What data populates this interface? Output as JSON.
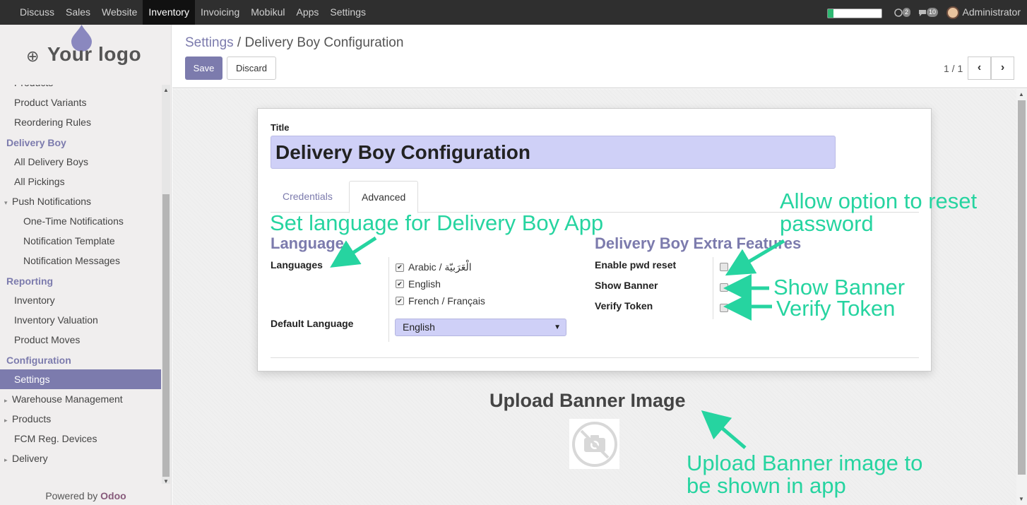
{
  "topbar": {
    "menu": [
      "Discuss",
      "Sales",
      "Website",
      "Inventory",
      "Invoicing",
      "Mobikul",
      "Apps",
      "Settings"
    ],
    "active": "Inventory",
    "progress_fraction": 0.1,
    "chat_count": "2",
    "message_count": "10",
    "user": "Administrator"
  },
  "sidebar": {
    "logo_text": "Your logo",
    "items": [
      {
        "label": "Products",
        "kind": "item"
      },
      {
        "label": "Product Variants",
        "kind": "item"
      },
      {
        "label": "Reordering Rules",
        "kind": "item"
      },
      {
        "label": "Delivery Boy",
        "kind": "head"
      },
      {
        "label": "All Delivery Boys",
        "kind": "item"
      },
      {
        "label": "All Pickings",
        "kind": "item"
      },
      {
        "label": "Push Notifications",
        "kind": "expanded"
      },
      {
        "label": "One-Time Notifications",
        "kind": "sub"
      },
      {
        "label": "Notification Template",
        "kind": "sub"
      },
      {
        "label": "Notification Messages",
        "kind": "sub"
      },
      {
        "label": "Reporting",
        "kind": "head"
      },
      {
        "label": "Inventory",
        "kind": "item"
      },
      {
        "label": "Inventory Valuation",
        "kind": "item"
      },
      {
        "label": "Product Moves",
        "kind": "item"
      },
      {
        "label": "Configuration",
        "kind": "head"
      },
      {
        "label": "Settings",
        "kind": "selected"
      },
      {
        "label": "Warehouse Management",
        "kind": "collapsed"
      },
      {
        "label": "Products",
        "kind": "collapsed"
      },
      {
        "label": "FCM Reg. Devices",
        "kind": "item"
      },
      {
        "label": "Delivery",
        "kind": "collapsed"
      }
    ],
    "powered_prefix": "Powered by",
    "powered_brand": "Odoo"
  },
  "control_panel": {
    "breadcrumb_parent": "Settings",
    "breadcrumb_sep": " / ",
    "breadcrumb_current": "Delivery Boy Configuration",
    "save_label": "Save",
    "discard_label": "Discard",
    "pager": "1 / 1"
  },
  "form": {
    "title_label": "Title",
    "title_value": "Delivery Boy Configuration",
    "tabs": [
      "Credentials",
      "Advanced"
    ],
    "active_tab": "Advanced",
    "language": {
      "section_title": "Language",
      "languages_label": "Languages",
      "options": [
        {
          "label": "Arabic / الْعَرَبيّة",
          "checked": true
        },
        {
          "label": "English",
          "checked": true
        },
        {
          "label": "French / Français",
          "checked": true
        }
      ],
      "default_label": "Default Language",
      "default_value": "English"
    },
    "extra": {
      "section_title": "Delivery Boy Extra Features",
      "fields": [
        {
          "label": "Enable pwd reset",
          "checked": false
        },
        {
          "label": "Show Banner",
          "checked": false
        },
        {
          "label": "Verify Token",
          "checked": false
        }
      ]
    },
    "upload_title": "Upload Banner Image"
  },
  "annotations": {
    "language": "Set language for Delivery Boy App",
    "reset_line1": "Allow option to reset",
    "reset_line2": "password",
    "banner": "Show Banner",
    "token": "Verify Token",
    "upload_line1": "Upload Banner image to",
    "upload_line2": "be shown in app"
  },
  "colors": {
    "primary": "#7c7bad",
    "annotation": "#26d4a0",
    "topbar": "#2f2f2f",
    "field_bg": "#cfd0f7"
  }
}
